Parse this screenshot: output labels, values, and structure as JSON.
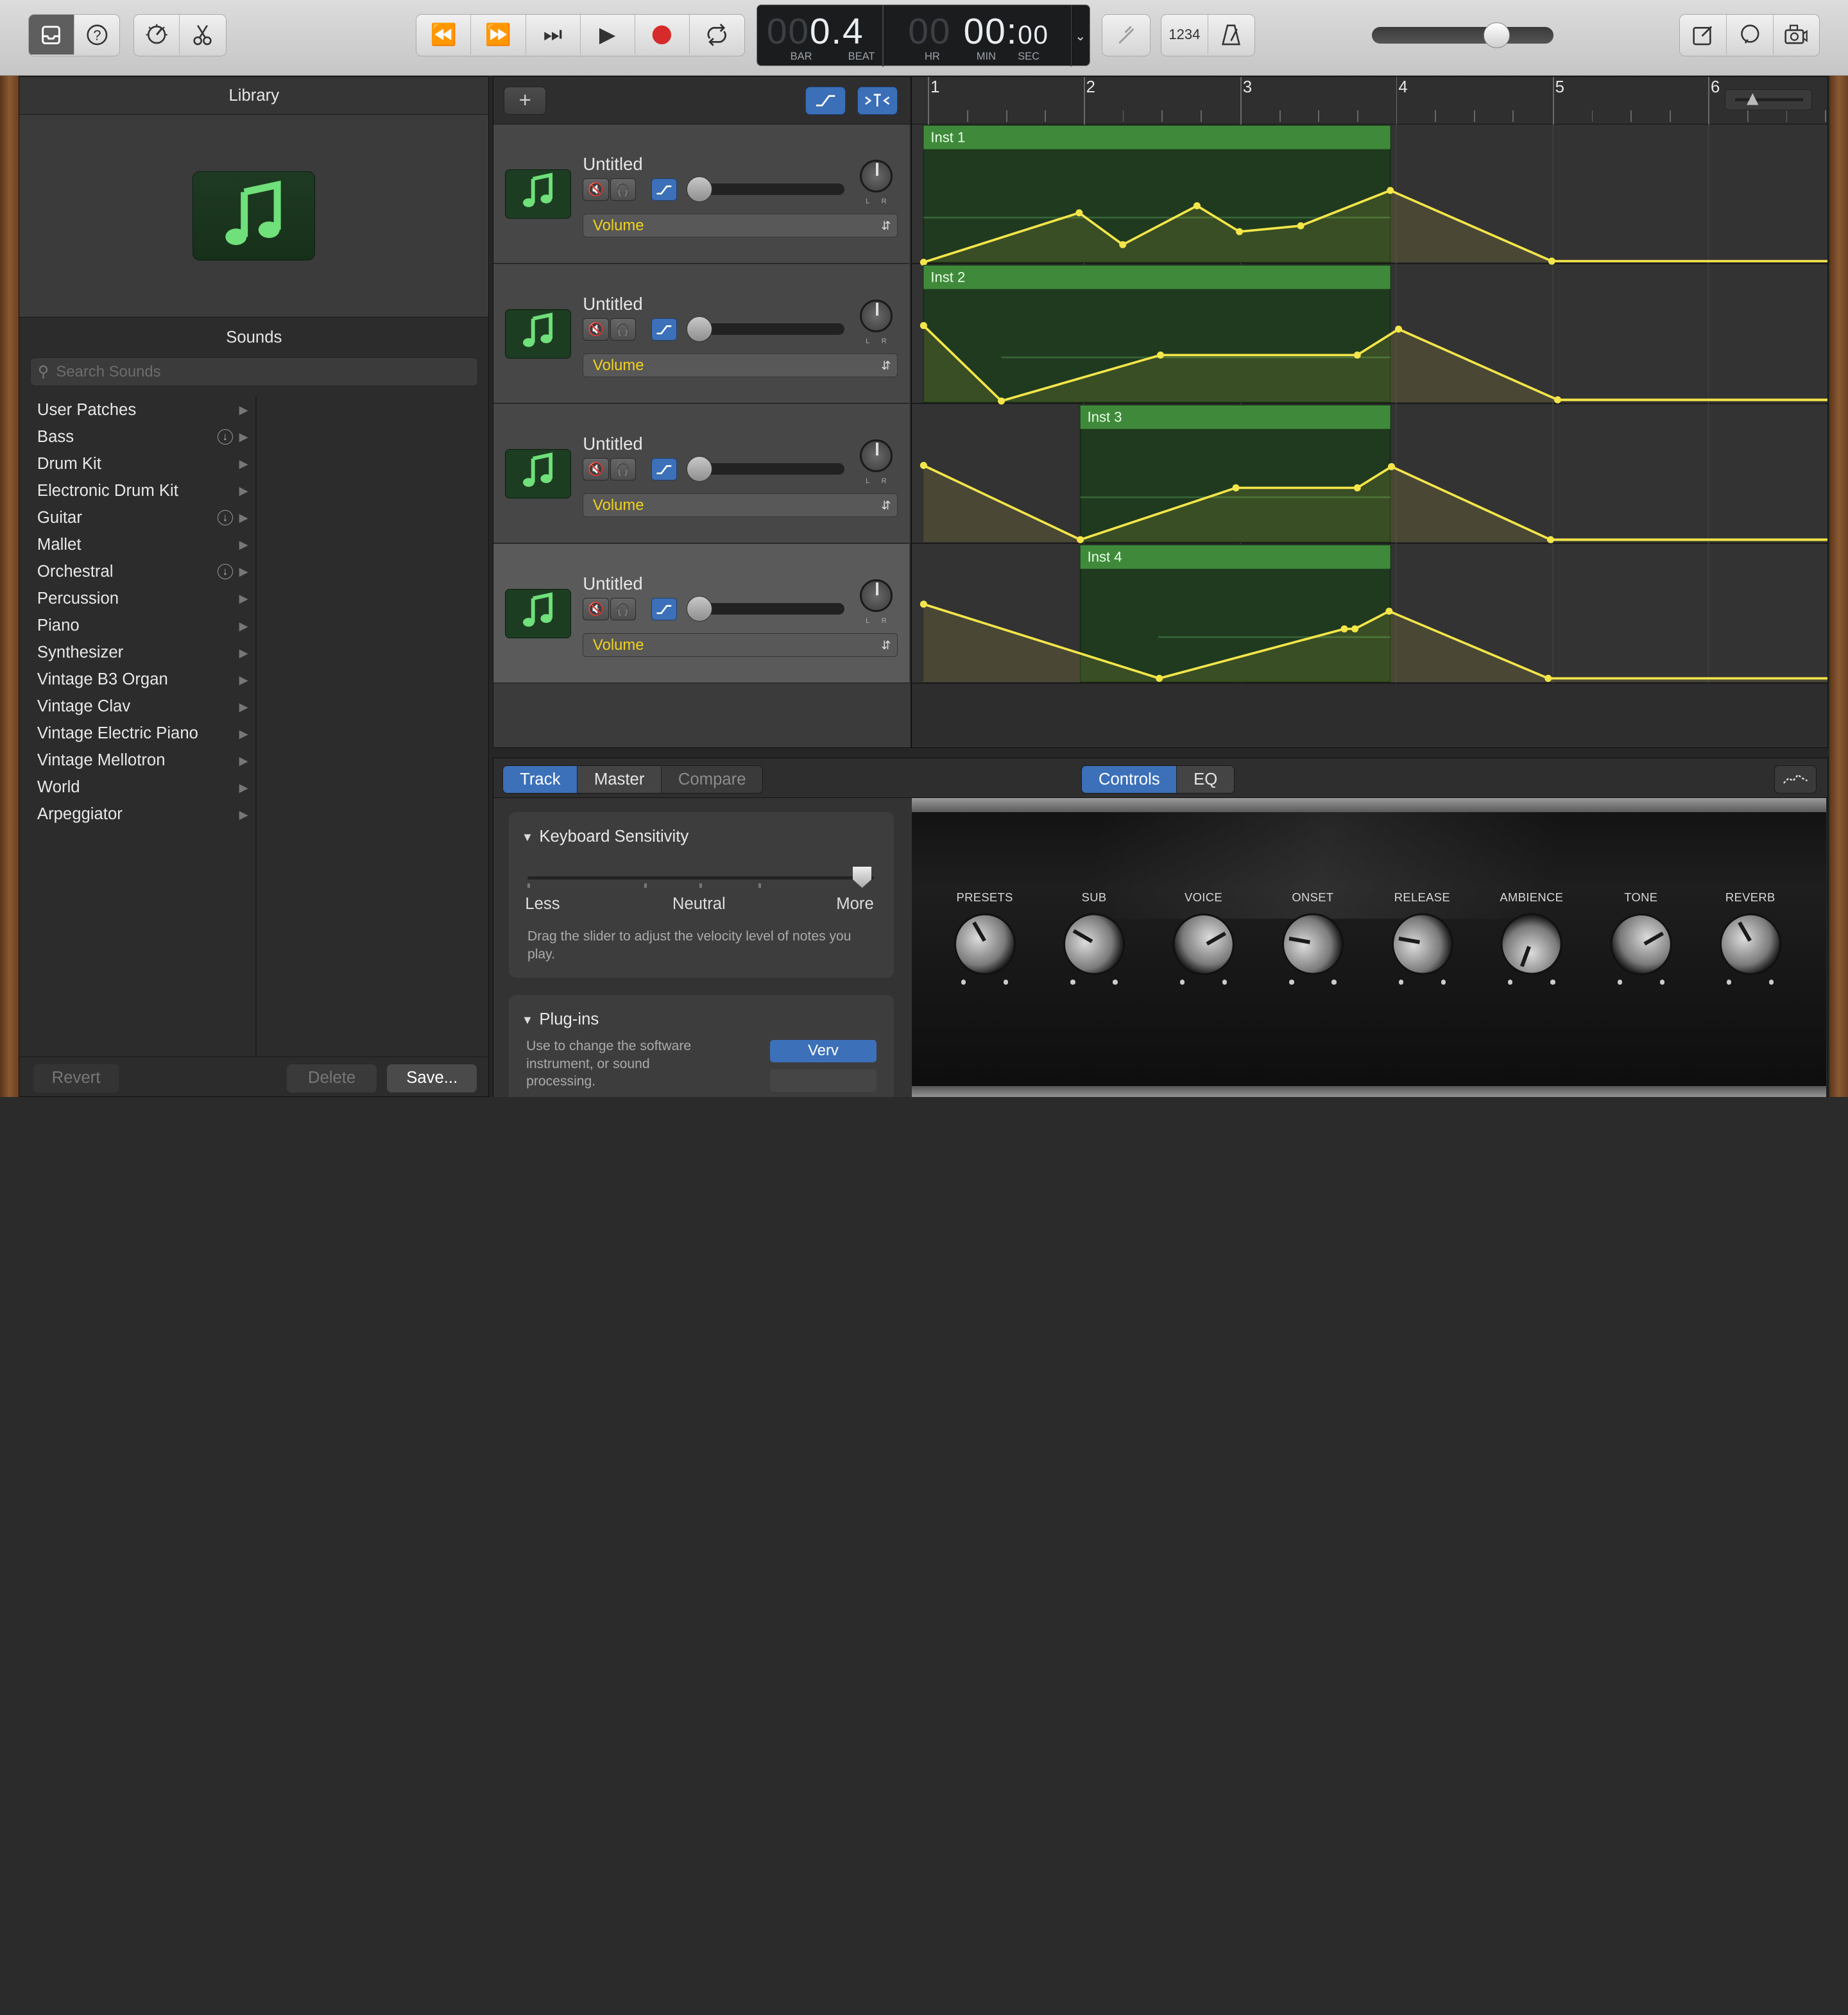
{
  "lcd": {
    "bar_dim": "00",
    "bar": "0",
    "beat": ".4",
    "bar_label": "BAR",
    "beat_label": "BEAT",
    "hr_dim": "00",
    "time": "00:",
    "time_sec": "00",
    "hr_label": "HR",
    "min_label": "MIN",
    "sec_label": "SEC"
  },
  "count_in_label": "1234",
  "library": {
    "title": "Library",
    "sounds_title": "Sounds",
    "search_placeholder": "Search Sounds",
    "items": [
      {
        "label": "User Patches",
        "download": false
      },
      {
        "label": "Bass",
        "download": true
      },
      {
        "label": "Drum Kit",
        "download": false
      },
      {
        "label": "Electronic Drum Kit",
        "download": false
      },
      {
        "label": "Guitar",
        "download": true
      },
      {
        "label": "Mallet",
        "download": false
      },
      {
        "label": "Orchestral",
        "download": true
      },
      {
        "label": "Percussion",
        "download": false
      },
      {
        "label": "Piano",
        "download": false
      },
      {
        "label": "Synthesizer",
        "download": false
      },
      {
        "label": "Vintage B3 Organ",
        "download": false
      },
      {
        "label": "Vintage Clav",
        "download": false
      },
      {
        "label": "Vintage Electric Piano",
        "download": false
      },
      {
        "label": "Vintage Mellotron",
        "download": false
      },
      {
        "label": "World",
        "download": false
      },
      {
        "label": "Arpeggiator",
        "download": false
      }
    ],
    "revert_label": "Revert",
    "delete_label": "Delete",
    "save_label": "Save..."
  },
  "tracks": [
    {
      "name": "Untitled",
      "automation": "Volume",
      "region": "Inst 1"
    },
    {
      "name": "Untitled",
      "automation": "Volume",
      "region": "Inst 2"
    },
    {
      "name": "Untitled",
      "automation": "Volume",
      "region": "Inst 3"
    },
    {
      "name": "Untitled",
      "automation": "Volume",
      "region": "Inst 4"
    }
  ],
  "ruler": [
    "1",
    "2",
    "3",
    "4",
    "5",
    "6"
  ],
  "editor": {
    "tabs_left": [
      "Track",
      "Master",
      "Compare"
    ],
    "tabs_right": [
      "Controls",
      "EQ"
    ],
    "keyboard_title": "Keyboard Sensitivity",
    "less": "Less",
    "neutral": "Neutral",
    "more": "More",
    "keyboard_desc": "Drag the slider to adjust the velocity level of notes you play.",
    "plugins_title": "Plug-ins",
    "plugins_desc": "Use to change the software instrument, or sound processing.",
    "plugin_name": "Verv",
    "knobs": [
      "PRESETS",
      "SUB",
      "VOICE",
      "ONSET",
      "RELEASE",
      "AMBIENCE",
      "TONE",
      "REVERB"
    ]
  },
  "colors": {
    "accent": "#3c70b8",
    "region_header": "#3f8a3a",
    "region_body": "#1f3a1f",
    "automation": "#f4e64a",
    "automation_label": "#f2d31b"
  }
}
